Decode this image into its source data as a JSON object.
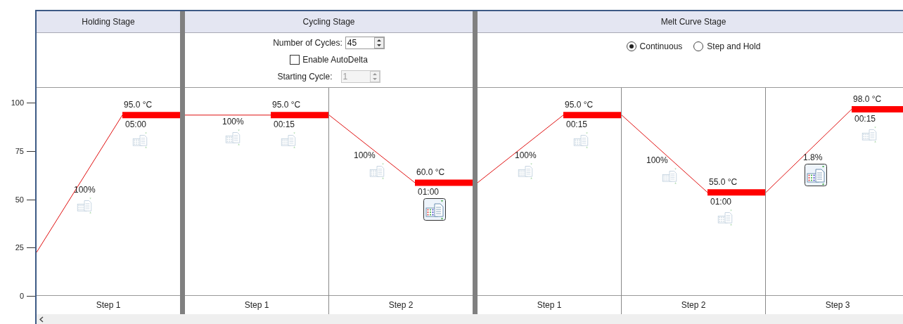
{
  "y_axis": {
    "ticks": [
      "100",
      "75",
      "50",
      "25",
      "0"
    ]
  },
  "stages": [
    {
      "kind": "holding",
      "title": "Holding Stage",
      "steps": [
        {
          "label": "Step 1",
          "ramp": {
            "rate": "100%",
            "collect": false
          },
          "hold": {
            "temperature": "95.0 °C",
            "time": "05:00",
            "collect": false
          }
        }
      ]
    },
    {
      "kind": "cycling",
      "title": "Cycling Stage",
      "settings": {
        "cycles_label": "Number of Cycles:",
        "cycles": "45",
        "autodelta_label": "Enable AutoDelta",
        "autodelta_checked": false,
        "starting_cycle_label": "Starting Cycle:",
        "starting_cycle": "1",
        "starting_cycle_disabled": true
      },
      "steps": [
        {
          "label": "Step 1",
          "ramp": {
            "rate": "100%",
            "collect": false
          },
          "hold": {
            "temperature": "95.0 °C",
            "time": "00:15",
            "collect": false
          }
        },
        {
          "label": "Step 2",
          "ramp": {
            "rate": "100%",
            "collect": false
          },
          "hold": {
            "temperature": "60.0 °C",
            "time": "01:00",
            "collect": true
          }
        }
      ]
    },
    {
      "kind": "melt",
      "title": "Melt Curve Stage",
      "modes": [
        {
          "label": "Continuous",
          "selected": true
        },
        {
          "label": "Step and Hold",
          "selected": false
        }
      ],
      "steps": [
        {
          "label": "Step 1",
          "ramp": {
            "rate": "100%",
            "collect": false
          },
          "hold": {
            "temperature": "95.0 °C",
            "time": "00:15",
            "collect": false
          }
        },
        {
          "label": "Step 2",
          "ramp": {
            "rate": "100%",
            "collect": false
          },
          "hold": {
            "temperature": "55.0 °C",
            "time": "01:00",
            "collect": false
          }
        },
        {
          "label": "Step 3",
          "ramp": {
            "rate": "1.8%",
            "collect": true
          },
          "hold": {
            "temperature": "98.0 °C",
            "time": "00:15",
            "collect": false
          }
        }
      ]
    }
  ]
}
